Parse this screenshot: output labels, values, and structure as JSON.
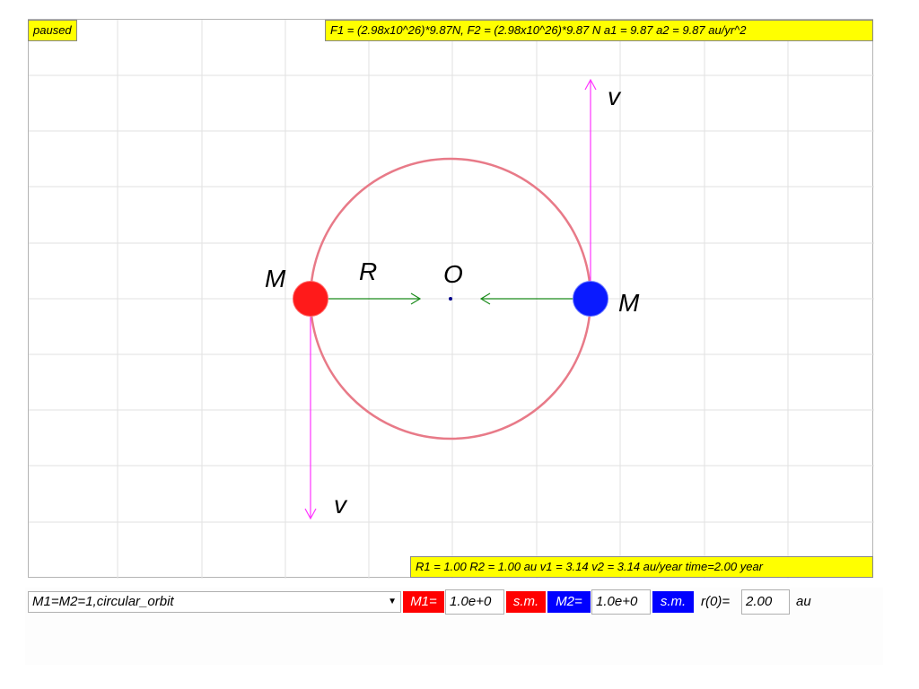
{
  "overlay": {
    "status": "paused",
    "force_text": "F1 = (2.98x10^26)*9.87N, F2 = (2.98x10^26)*9.87 N a1 = 9.87 a2 = 9.87 au/yr^2",
    "orbit_text": "R1 = 1.00 R2 = 1.00 au v1 = 3.14 v2 = 3.14 au/year time=2.00 year"
  },
  "scene": {
    "label_mass_left": "M",
    "label_mass_right": "M",
    "label_radius": "R",
    "label_origin": "O",
    "label_velocity_top": "v",
    "label_velocity_bottom": "v",
    "colors": {
      "mass1": "#ff1a1a",
      "mass2": "#0a1aff",
      "orbit": "#e87a88",
      "force_arrow": "#1a8a1a",
      "velocity_arrow": "#ff33ff",
      "grid": "#e2e2e2"
    }
  },
  "controls": {
    "scenario": "M1=M2=1,circular_orbit",
    "m1_label": "M1=",
    "m1_value": "1.0e+0",
    "m1_unit": "s.m.",
    "m2_label": "M2=",
    "m2_value": "1.0e+0",
    "m2_unit": "s.m.",
    "r0_label": "r(0)=",
    "r0_value": "2.00",
    "r0_unit": "au"
  }
}
